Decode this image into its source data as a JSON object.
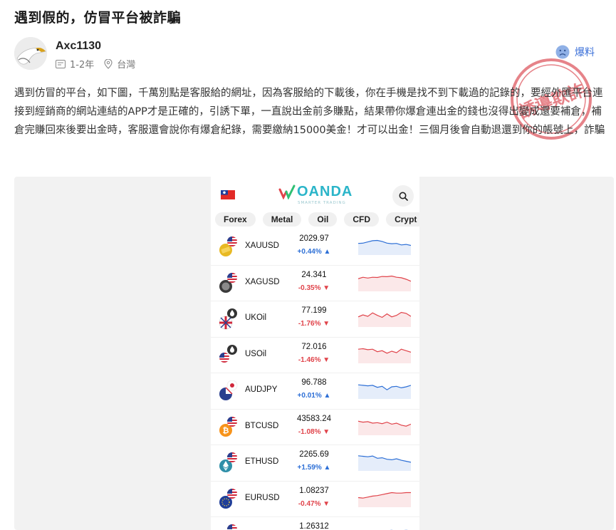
{
  "post": {
    "title": "遇到假的，仿冒平台被詐騙",
    "author": "Axc1130",
    "duration": "1-2年",
    "location": "台灣",
    "report_label": "爆料",
    "stamp_text": "誘導欺詐",
    "body": "遇到仿冒的平台，如下圖，千萬別點是客服給的網址，因為客服給的下載後，你在手機是找不到下載過的記錄的，要經外匯平台連接到經銷商的網站連結的APP才是正確的，引誘下單，一直說出金前多賺點，結果帶你爆倉連出金的錢也沒得出變成還要補倉，補倉完賺回來後要出金時，客服還會說你有爆倉紀錄，需要繳納15000美金！才可以出金！三個月後會自動退還到你的帳號上，詐騙"
  },
  "app": {
    "logo": "OANDA",
    "logo_sub": "SMARTER TRADING",
    "tabs": [
      "Forex",
      "Metal",
      "Oil",
      "CFD",
      "Crypt"
    ],
    "colors": {
      "up": "#2d6fd6",
      "down": "#e0434a",
      "brand": "#2bb5c9"
    },
    "quotes": [
      {
        "symbol": "XAUUSD",
        "price": "2029.97",
        "change": "+0.44%",
        "dir": "up",
        "arrow": "▲",
        "icon": "gold-coin-icon",
        "spark": [
          0.55,
          0.52,
          0.4,
          0.28,
          0.25,
          0.35,
          0.52,
          0.58,
          0.55,
          0.7,
          0.65,
          0.75
        ]
      },
      {
        "symbol": "XAGUSD",
        "price": "24.341",
        "change": "-0.35%",
        "dir": "down",
        "arrow": "▼",
        "icon": "silver-coin-icon",
        "spark": [
          0.45,
          0.3,
          0.38,
          0.3,
          0.32,
          0.22,
          0.24,
          0.18,
          0.3,
          0.35,
          0.5,
          0.7
        ]
      },
      {
        "symbol": "UKOil",
        "price": "77.199",
        "change": "-1.76%",
        "dir": "down",
        "arrow": "▼",
        "icon": "oil-drop-icon",
        "spark": [
          0.7,
          0.5,
          0.65,
          0.3,
          0.55,
          0.75,
          0.4,
          0.7,
          0.55,
          0.25,
          0.35,
          0.65
        ]
      },
      {
        "symbol": "USOil",
        "price": "72.016",
        "change": "-1.46%",
        "dir": "down",
        "arrow": "▼",
        "icon": "oil-drop-icon",
        "spark": [
          0.3,
          0.25,
          0.35,
          0.3,
          0.55,
          0.45,
          0.7,
          0.5,
          0.65,
          0.3,
          0.45,
          0.6
        ]
      },
      {
        "symbol": "AUDJPY",
        "price": "96.788",
        "change": "+0.01%",
        "dir": "up",
        "arrow": "▲",
        "icon": "jp-flag-icon",
        "spark": [
          0.3,
          0.35,
          0.4,
          0.35,
          0.55,
          0.45,
          0.8,
          0.5,
          0.45,
          0.6,
          0.5,
          0.35
        ]
      },
      {
        "symbol": "BTCUSD",
        "price": "43583.24",
        "change": "-1.08%",
        "dir": "down",
        "arrow": "▼",
        "icon": "bitcoin-icon",
        "spark": [
          0.3,
          0.4,
          0.35,
          0.5,
          0.45,
          0.55,
          0.4,
          0.6,
          0.5,
          0.7,
          0.8,
          0.6
        ]
      },
      {
        "symbol": "ETHUSD",
        "price": "2265.69",
        "change": "+1.59%",
        "dir": "up",
        "arrow": "▲",
        "icon": "ethereum-icon",
        "spark": [
          0.2,
          0.25,
          0.3,
          0.22,
          0.45,
          0.4,
          0.55,
          0.6,
          0.5,
          0.65,
          0.75,
          0.85
        ]
      },
      {
        "symbol": "EURUSD",
        "price": "1.08237",
        "change": "-0.47%",
        "dir": "down",
        "arrow": "▼",
        "icon": "eu-flag-icon",
        "spark": [
          0.75,
          0.8,
          0.7,
          0.6,
          0.55,
          0.45,
          0.35,
          0.25,
          0.3,
          0.3,
          0.25,
          0.25
        ]
      },
      {
        "symbol": "",
        "price": "1.26312",
        "change": "",
        "dir": "up",
        "arrow": "",
        "icon": "us-flag-icon",
        "spark": [
          0.6,
          0.55,
          0.5,
          0.55,
          0.65,
          0.6,
          0.5,
          0.45,
          0.55,
          0.5,
          0.45,
          0.5
        ]
      }
    ]
  }
}
